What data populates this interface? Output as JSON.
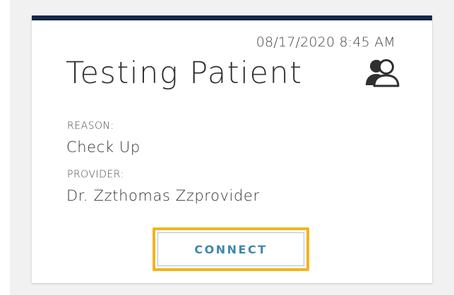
{
  "appointment_card": {
    "timestamp": "08/17/2020 8:45 AM",
    "patient_name": "Testing Patient",
    "patient_icon": "users-icon",
    "reason": {
      "label": "REASON:",
      "value": "Check Up"
    },
    "provider": {
      "label": "PROVIDER:",
      "value": "Dr. Zzthomas Zzprovider"
    },
    "connect_label": "CONNECT"
  },
  "colors": {
    "card_top_border": "#142848",
    "button_text": "#3e86ad",
    "button_border": "#a4c5d8",
    "focus_highlight": "#f3b41b",
    "background": "#f1f1f1"
  }
}
